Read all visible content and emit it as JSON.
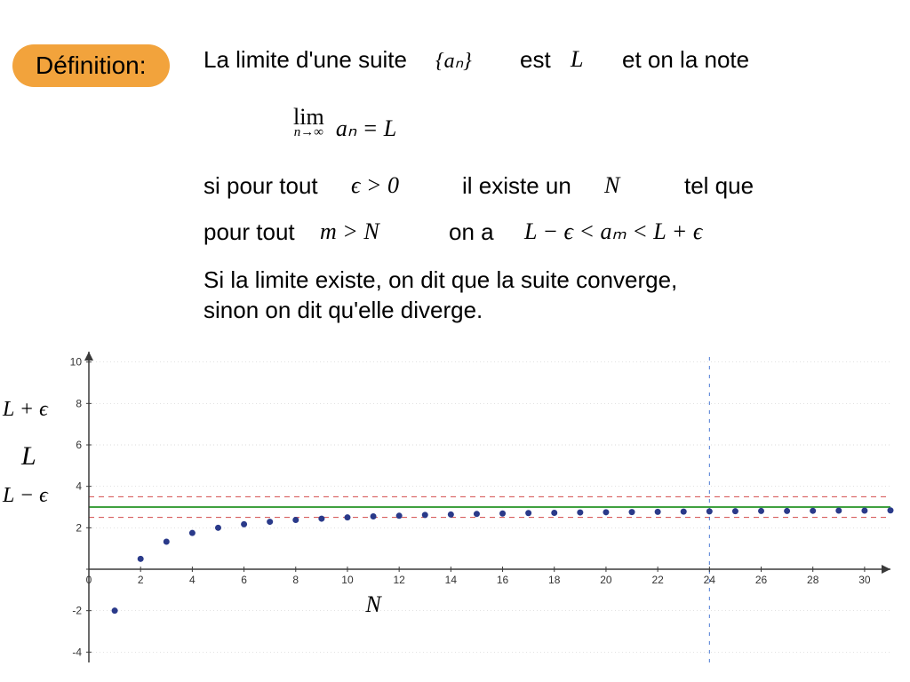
{
  "badge": "Définition:",
  "line1": {
    "a": "La limite d'une suite",
    "seq": "{aₙ}",
    "b": "est",
    "L": "L",
    "c": "et on la note"
  },
  "limit": {
    "a": "lim",
    "sub": "n→∞",
    "b": "aₙ = L"
  },
  "line2": {
    "a": "si pour tout",
    "eps": "ϵ > 0",
    "b": "il existe un",
    "N": "N",
    "c": "tel que"
  },
  "line3": {
    "a": "pour tout",
    "mN": "m > N",
    "b": "on a",
    "ineq": "L − ϵ < aₘ < L + ϵ"
  },
  "line4a": "Si la limite existe, on dit que la suite converge,",
  "line4b": "sinon on dit qu'elle diverge.",
  "yAxisLabels": {
    "top": "L + ϵ",
    "mid": "L",
    "bot": "L − ϵ"
  },
  "chart_data": {
    "type": "scatter",
    "xlabel": "N",
    "x_ticks": [
      0,
      2,
      4,
      6,
      8,
      10,
      12,
      14,
      16,
      18,
      20,
      22,
      24,
      26,
      28,
      30
    ],
    "y_ticks": [
      -4,
      -2,
      0,
      2,
      4,
      6,
      8,
      10
    ],
    "L": 3,
    "epsilon": 0.5,
    "N_mark": 24,
    "xlim": [
      0,
      31
    ],
    "ylim": [
      -4.5,
      10.5
    ],
    "series": [
      {
        "name": "a_n",
        "x": [
          1,
          2,
          3,
          4,
          5,
          6,
          7,
          8,
          9,
          10,
          11,
          12,
          13,
          14,
          15,
          16,
          17,
          18,
          19,
          20,
          21,
          22,
          23,
          24,
          25,
          26,
          27,
          28,
          29,
          30,
          31
        ],
        "y": [
          -2.0,
          0.5,
          1.33,
          1.75,
          2.0,
          2.17,
          2.29,
          2.38,
          2.44,
          2.5,
          2.55,
          2.58,
          2.62,
          2.64,
          2.67,
          2.69,
          2.71,
          2.72,
          2.74,
          2.75,
          2.76,
          2.77,
          2.78,
          2.79,
          2.8,
          2.81,
          2.81,
          2.82,
          2.83,
          2.83,
          2.84
        ]
      }
    ]
  }
}
